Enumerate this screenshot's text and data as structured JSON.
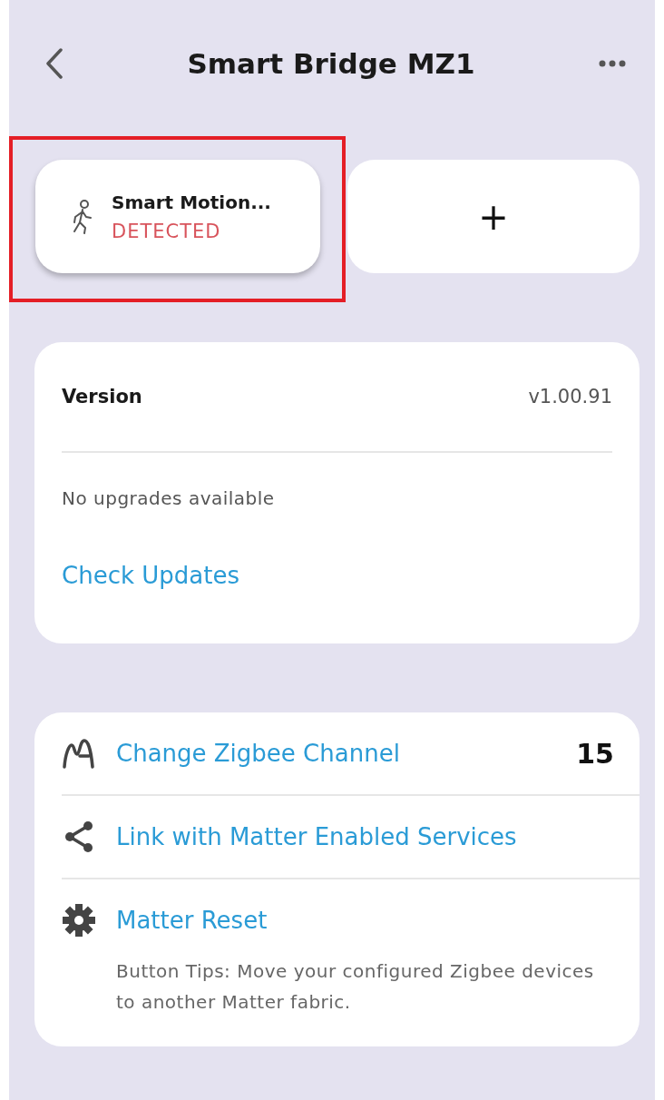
{
  "header": {
    "title": "Smart Bridge MZ1"
  },
  "devices": [
    {
      "name": "Smart Motion...",
      "status": "DETECTED",
      "alert": true,
      "highlighted": true
    }
  ],
  "add_tile": {
    "label": "+"
  },
  "version_card": {
    "label": "Version",
    "value": "v1.00.91",
    "message": "No upgrades available",
    "action": "Check Updates"
  },
  "actions": [
    {
      "kind": "signal",
      "label": "Change Zigbee Channel",
      "value": "15"
    },
    {
      "kind": "share",
      "label": "Link with Matter Enabled Services"
    },
    {
      "kind": "gear",
      "label": "Matter Reset",
      "note": "Button Tips: Move your configured Zigbee devices to another Matter fabric."
    }
  ]
}
